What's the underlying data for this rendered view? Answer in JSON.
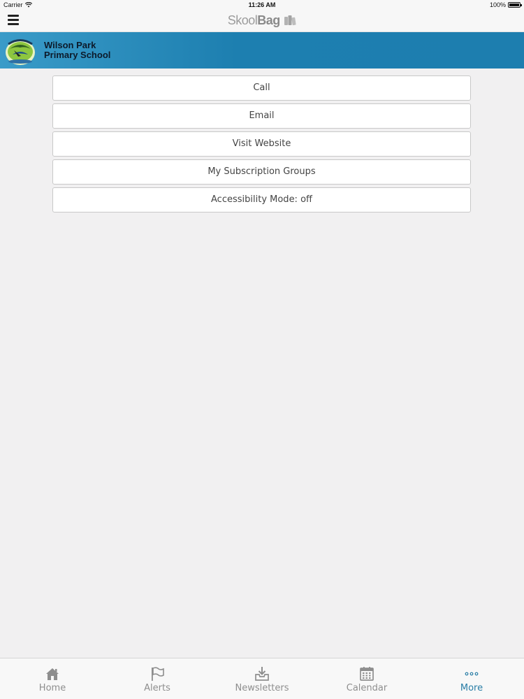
{
  "status_bar": {
    "carrier": "Carrier",
    "time": "11:26 AM",
    "battery": "100%"
  },
  "nav": {
    "logo_light": "Skool",
    "logo_bold": "Bag"
  },
  "school": {
    "name_line1": "Wilson Park",
    "name_line2": "Primary School",
    "crest_icon": "school-crest-logo"
  },
  "actions": [
    {
      "label": "Call"
    },
    {
      "label": "Email"
    },
    {
      "label": "Visit Website"
    },
    {
      "label": "My Subscription Groups"
    },
    {
      "label": "Accessibility Mode: off"
    }
  ],
  "tabs": [
    {
      "label": "Home",
      "icon": "home-icon",
      "active": false
    },
    {
      "label": "Alerts",
      "icon": "flag-icon",
      "active": false
    },
    {
      "label": "Newsletters",
      "icon": "inbox-download-icon",
      "active": false
    },
    {
      "label": "Calendar",
      "icon": "calendar-icon",
      "active": false
    },
    {
      "label": "More",
      "icon": "more-dots-icon",
      "active": true
    }
  ],
  "colors": {
    "banner": "#1d7fb0",
    "active_tab": "#2a7ea6",
    "background": "#f1f0f1"
  }
}
